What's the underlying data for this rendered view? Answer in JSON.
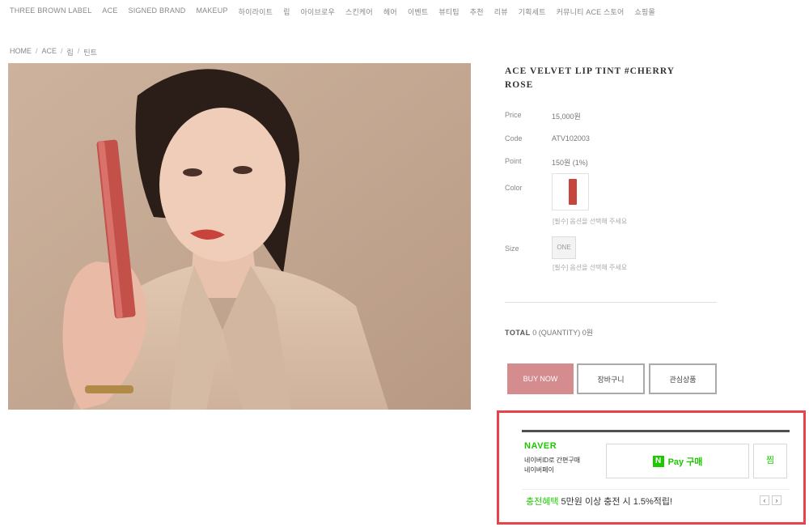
{
  "nav": {
    "items": [
      "THREE BROWN LABEL",
      "ACE",
      "SIGNED BRAND",
      "MAKEUP",
      "하이라이트",
      "립",
      "아이브로우",
      "스킨케어",
      "헤어",
      "이벤트",
      "뷰티팁",
      "추천",
      "리뷰",
      "기획세트",
      "커뮤니티 ACE 스토어",
      "쇼핑몰"
    ]
  },
  "breadcrumb": [
    "HOME",
    "ACE",
    "립",
    "틴트"
  ],
  "product": {
    "title": "ACE VELVET LIP TINT #CHERRY ROSE",
    "specs": [
      {
        "label": "Price",
        "value": "15,000원"
      },
      {
        "label": "Code",
        "value": "ATV102003"
      },
      {
        "label": "Point",
        "value": "150원 (1%)"
      }
    ],
    "color_label": "Color",
    "color_note": "[필수] 옵션을 선택해 주세요",
    "size_label": "Size",
    "size_value": "ONE",
    "size_note": "[필수] 옵션을 선택해 주세요",
    "total_label": "TOTAL",
    "total_value": "0 (QUANTITY)",
    "total_amount": "0원"
  },
  "buttons": {
    "buy": "BUY NOW",
    "cart": "장바구니",
    "wish": "관심상품"
  },
  "naverpay": {
    "brand": "NAVER",
    "desc_line1": "네이버ID로 간편구매",
    "desc_line2": "네이버페이",
    "logo_letter": "N",
    "pay_label": "Pay 구매",
    "zzim_label": "찜",
    "promo_highlight": "충전혜택",
    "promo_text": " 5만원 이상 충전 시 1.5%적립!",
    "prev_icon": "‹",
    "next_icon": "›"
  },
  "colors": {
    "accent_pink": "#d48c8f",
    "naver_green": "#1ec800",
    "highlight_red": "#e8434b"
  }
}
